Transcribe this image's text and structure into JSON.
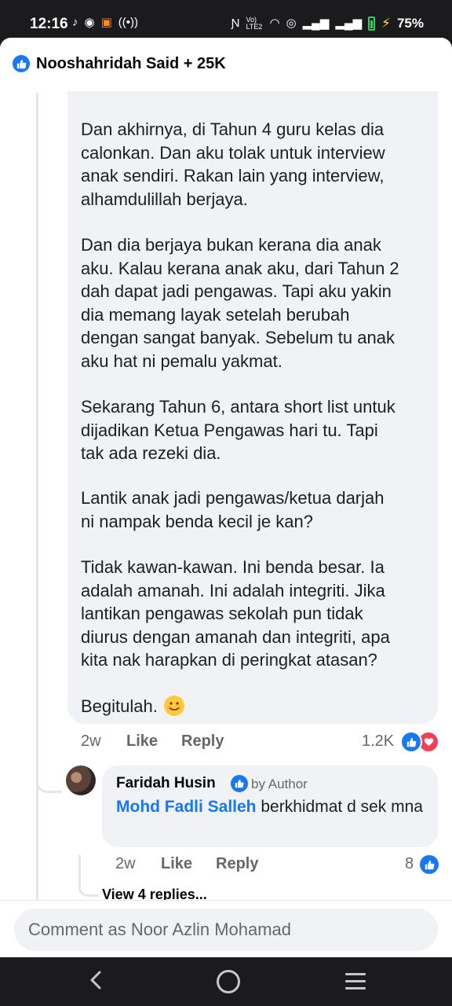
{
  "status_bar": {
    "time": "12:16",
    "icons": [
      "tiktok-icon",
      "messenger-icon",
      "shopee-icon",
      "hotspot-icon"
    ],
    "right_icons": [
      "nfc-icon",
      "volte-icon",
      "wifi-icon",
      "signal-icon",
      "signal-icon",
      "battery-icon"
    ],
    "volte_label": "Vo) LTE2",
    "battery": "75%"
  },
  "header": {
    "title": "Nooshahridah Said + 25K"
  },
  "comment": {
    "partial_line": "",
    "paragraphs": [
      "Dan akhirnya, di Tahun 4 guru kelas dia\ncalonkan. Dan aku tolak untuk interview\nanak sendiri. Rakan lain yang interview,\nalhamdulillah berjaya.",
      "Dan dia berjaya bukan kerana dia anak\naku. Kalau kerana anak aku, dari Tahun 2\ndah dapat jadi pengawas. Tapi aku yakin\ndia memang layak setelah berubah\ndengan sangat banyak. Sebelum tu anak\naku hat ni pemalu yakmat.",
      "Sekarang Tahun 6, antara short list untuk\ndijadikan Ketua Pengawas hari tu. Tapi\ntak ada rezeki dia.",
      "Lantik anak jadi pengawas/ketua darjah\nni nampak benda kecil je kan?",
      "Tidak kawan-kawan. Ini benda besar. Ia\nadalah amanah. Ini adalah integriti. Jika\nlantikan pengawas sekolah pun tidak\ndiurus dengan amanah dan integriti, apa\nkita nak harapkan di peringkat atasan?",
      "Begitulah."
    ],
    "emoji": "smiling-face-emoji",
    "time": "2w",
    "like_label": "Like",
    "reply_label": "Reply",
    "reaction_count": "1.2K",
    "reactions": [
      "like",
      "love"
    ]
  },
  "reply": {
    "author": "Faridah Husin",
    "author_tag": "by Author",
    "mention": "Mohd Fadli Salleh",
    "text": " berkhidmat d sek mna",
    "time": "2w",
    "like_label": "Like",
    "reply_label": "Reply",
    "reaction_count": "8"
  },
  "view_replies": "View 4 replies...",
  "composer": {
    "placeholder": "Comment as Noor Azlin Mohamad"
  },
  "colors": {
    "accent": "#1877f2",
    "love": "#f33e58",
    "bubble": "#f0f2f5",
    "muted": "#65676b"
  }
}
